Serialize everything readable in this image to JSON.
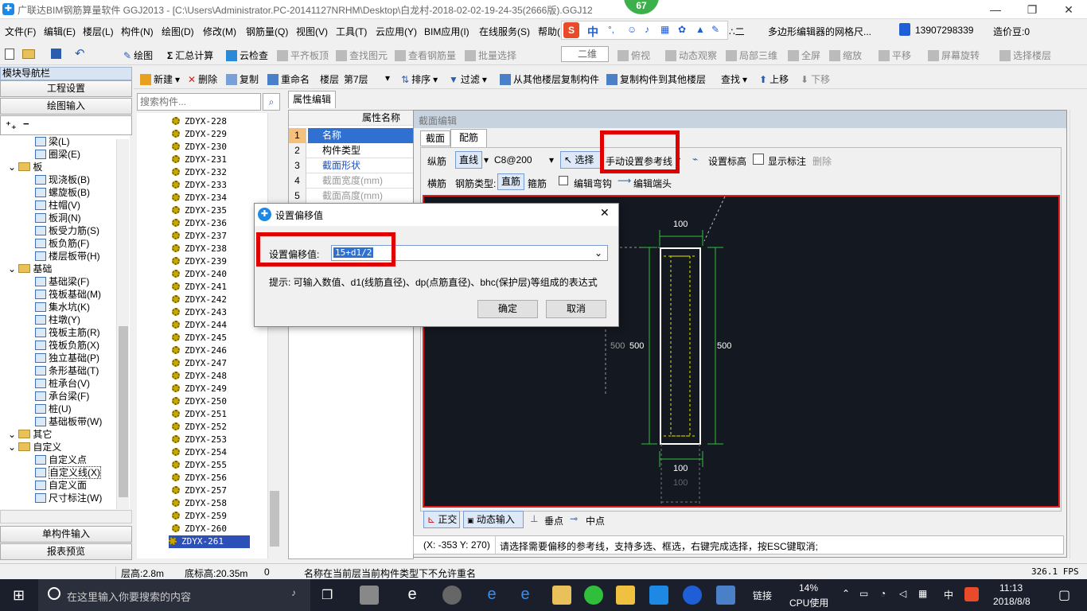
{
  "window": {
    "title": "广联达BIM钢筋算量软件 GGJ2013 - [C:\\Users\\Administrator.PC-20141127NRHM\\Desktop\\白龙村-2018-02-02-19-24-35(2666版).GGJ12",
    "badge": "67",
    "minimize": "—",
    "restore": "❐",
    "close": "✕"
  },
  "menu": [
    "文件(F)",
    "编辑(E)",
    "楼层(L)",
    "构件(N)",
    "绘图(D)",
    "修改(M)",
    "钢筋量(Q)",
    "视图(V)",
    "工具(T)",
    "云应用(Y)",
    "BIM应用(I)",
    "在线服务(S)",
    "帮助(H"
  ],
  "ime": {
    "logo": "S",
    "lang": "中",
    "punc": "°,",
    "extra": "∴二"
  },
  "notice": "多边形编辑器的网格尺...",
  "account": {
    "phone": "13907298339",
    "coins": "造价豆:0"
  },
  "toolbar1": [
    {
      "label": "绘图"
    },
    {
      "label": "汇总计算"
    },
    {
      "label": "云检查"
    },
    {
      "label": "平齐板顶"
    },
    {
      "label": "查找图元"
    },
    {
      "label": "查看钢筋量"
    },
    {
      "label": "批量选择"
    },
    {
      "label": "二维"
    },
    {
      "label": "俯视"
    },
    {
      "label": "动态观察"
    },
    {
      "label": "局部三维"
    },
    {
      "label": "全屏"
    },
    {
      "label": "缩放"
    },
    {
      "label": "平移"
    },
    {
      "label": "屏幕旋转"
    },
    {
      "label": "选择楼层"
    }
  ],
  "toolbar2": {
    "new": "新建",
    "delete": "删除",
    "copy": "复制",
    "rename": "重命名",
    "floor_label": "楼层",
    "floor_value": "第7层",
    "sort": "排序",
    "filter": "过滤",
    "copy_from": "从其他楼层复制构件",
    "copy_to": "复制构件到其他楼层",
    "find": "查找",
    "up": "上移",
    "down": "下移"
  },
  "nav": {
    "header": "模块导航栏",
    "project_settings": "工程设置",
    "draw_input": "绘图输入",
    "single_input": "单构件输入",
    "report": "报表预览",
    "tree": [
      {
        "label": "梁(L)",
        "indent": 2
      },
      {
        "label": "圈梁(E)",
        "indent": 2
      },
      {
        "label": "板",
        "indent": 0,
        "folder": true
      },
      {
        "label": "现浇板(B)",
        "indent": 2
      },
      {
        "label": "螺旋板(B)",
        "indent": 2
      },
      {
        "label": "柱帽(V)",
        "indent": 2
      },
      {
        "label": "板洞(N)",
        "indent": 2
      },
      {
        "label": "板受力筋(S)",
        "indent": 2
      },
      {
        "label": "板负筋(F)",
        "indent": 2
      },
      {
        "label": "楼层板带(H)",
        "indent": 2
      },
      {
        "label": "基础",
        "indent": 0,
        "folder": true
      },
      {
        "label": "基础梁(F)",
        "indent": 2
      },
      {
        "label": "筏板基础(M)",
        "indent": 2
      },
      {
        "label": "集水坑(K)",
        "indent": 2
      },
      {
        "label": "柱墩(Y)",
        "indent": 2
      },
      {
        "label": "筏板主筋(R)",
        "indent": 2
      },
      {
        "label": "筏板负筋(X)",
        "indent": 2
      },
      {
        "label": "独立基础(P)",
        "indent": 2
      },
      {
        "label": "条形基础(T)",
        "indent": 2
      },
      {
        "label": "桩承台(V)",
        "indent": 2
      },
      {
        "label": "承台梁(F)",
        "indent": 2
      },
      {
        "label": "桩(U)",
        "indent": 2
      },
      {
        "label": "基础板带(W)",
        "indent": 2
      },
      {
        "label": "其它",
        "indent": 0,
        "folder": true
      },
      {
        "label": "自定义",
        "indent": 0,
        "folder": true
      },
      {
        "label": "自定义点",
        "indent": 2
      },
      {
        "label": "自定义线(X)",
        "indent": 2,
        "selected": true
      },
      {
        "label": "自定义面",
        "indent": 2
      },
      {
        "label": "尺寸标注(W)",
        "indent": 2
      }
    ]
  },
  "search": {
    "placeholder": "搜索构件..."
  },
  "components": [
    "ZDYX-228",
    "ZDYX-229",
    "ZDYX-230",
    "ZDYX-231",
    "ZDYX-232",
    "ZDYX-233",
    "ZDYX-234",
    "ZDYX-235",
    "ZDYX-236",
    "ZDYX-237",
    "ZDYX-238",
    "ZDYX-239",
    "ZDYX-240",
    "ZDYX-241",
    "ZDYX-242",
    "ZDYX-243",
    "ZDYX-244",
    "ZDYX-245",
    "ZDYX-246",
    "ZDYX-247",
    "ZDYX-248",
    "ZDYX-249",
    "ZDYX-250",
    "ZDYX-251",
    "ZDYX-252",
    "ZDYX-253",
    "ZDYX-254",
    "ZDYX-255",
    "ZDYX-256",
    "ZDYX-257",
    "ZDYX-258",
    "ZDYX-259",
    "ZDYX-260",
    "ZDYX-261"
  ],
  "props": {
    "tab": "属性编辑",
    "col": "属性名称",
    "rows": [
      {
        "n": "1",
        "v": "名称"
      },
      {
        "n": "2",
        "v": "构件类型"
      },
      {
        "n": "3",
        "v": "截面形状"
      },
      {
        "n": "4",
        "v": "截面宽度(mm)"
      },
      {
        "n": "5",
        "v": "截面高度(mm)"
      }
    ]
  },
  "section": {
    "title": "截面编辑",
    "tab1": "截面",
    "tab2": "配筋",
    "longbar": "纵筋",
    "linetype": "直线",
    "spec": "C8@200",
    "select": "选择",
    "manual_ref": "手动设置参考线",
    "set_height": "设置标高",
    "show_dim": "显示标注",
    "delete": "删除",
    "transverse": "横筋",
    "bartype_label": "钢筋类型:",
    "straight": "直筋",
    "stirrup": "箍筋",
    "edit_hook": "编辑弯钩",
    "edit_end": "编辑端头",
    "dims": {
      "top": "100",
      "left_out": "500",
      "left_in": "500",
      "right": "500",
      "bottom": "100",
      "bottom2": "100"
    },
    "ortho": "正交",
    "dyninput": "动态输入",
    "perp": "垂点",
    "mid": "中点",
    "coords": "(X: -353 Y: 270)",
    "hint": "请选择需要偏移的参考线，支持多选、框选，右键完成选择，按ESC键取消;"
  },
  "dialog": {
    "title": "设置偏移值",
    "label": "设置偏移值:",
    "value": "15+d1/2",
    "tip": "提示: 可输入数值、d1(线筋直径)、dp(点筋直径)、bhc(保护层)等组成的表达式",
    "ok": "确定",
    "cancel": "取消",
    "close": "✕"
  },
  "status": {
    "floor_h": "层高:2.8m",
    "bottom_h": "底标高:20.35m",
    "zero": "0",
    "msg": "名称在当前层当前构件类型下不允许重名",
    "fps": "326.1 FPS"
  },
  "taskbar": {
    "search_placeholder": "在这里输入你要搜索的内容",
    "link": "链接",
    "cpu": "14%",
    "cpu_label": "CPU使用",
    "ime": "中",
    "time": "11:13",
    "date": "2018/8/8"
  }
}
